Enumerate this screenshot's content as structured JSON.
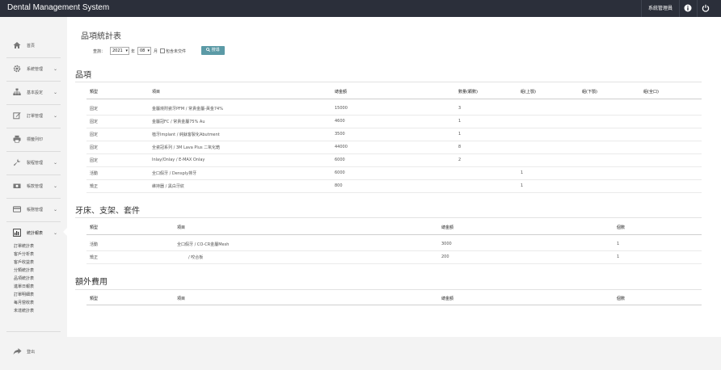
{
  "app": {
    "title": "Dental Management System",
    "admin_label": "系統管理員"
  },
  "sidebar": {
    "items": [
      {
        "label": "首頁",
        "icon": "home-icon",
        "has_sub": false
      },
      {
        "label": "系統管理",
        "icon": "gear-icon",
        "has_sub": true
      },
      {
        "label": "基本設定",
        "icon": "sitemap-icon",
        "has_sub": true
      },
      {
        "label": "訂單管理",
        "icon": "edit-icon",
        "has_sub": true
      },
      {
        "label": "標籤列印",
        "icon": "printer-icon",
        "has_sub": false
      },
      {
        "label": "製程管理",
        "icon": "wrench-icon",
        "has_sub": true
      },
      {
        "label": "帳款管理",
        "icon": "money-icon",
        "has_sub": true
      },
      {
        "label": "帳務管理",
        "icon": "card-icon",
        "has_sub": true
      },
      {
        "label": "統計報表",
        "icon": "chart-icon",
        "has_sub": true
      }
    ],
    "subitems": [
      "訂單統計表",
      "客戶分析表",
      "客戶收益表",
      "分類統計表",
      "品項統計表",
      "進單日報表",
      "訂單明細表",
      "每月營收表",
      "未達統計表"
    ],
    "logout_label": "登出"
  },
  "page": {
    "title": "品項統計表",
    "filter": {
      "query_label": "查詢：",
      "year": "2021",
      "year_unit": "年",
      "month": "08",
      "month_unit": "月",
      "checkbox_label": "包含未交件",
      "search_label": "搜尋"
    }
  },
  "sections": {
    "items": {
      "title": "品項",
      "headers": [
        "類型",
        "項目",
        "總金額",
        "數量(顆數)",
        "組(上顎)",
        "組(下顎)",
        "組(全口)"
      ],
      "rows": [
        [
          "固定",
          "金屬燒附瓷牙PFM  /  常貴金屬-黃金74%",
          "15000",
          "3",
          "",
          "",
          ""
        ],
        [
          "固定",
          "金屬冠FC  /  常貴金屬75% Au",
          "4600",
          "1",
          "",
          "",
          ""
        ],
        [
          "固定",
          "植牙Implant  /  純鈦客製化Abutment",
          "3500",
          "1",
          "",
          "",
          ""
        ],
        [
          "固定",
          "全瓷冠系列  /  3M Lava Plus 二氧化鋯",
          "44000",
          "8",
          "",
          "",
          ""
        ],
        [
          "固定",
          "Inlay/Onlay  /  E-MAX Onlay",
          "6000",
          "2",
          "",
          "",
          ""
        ],
        [
          "活動",
          "全口假牙  /  Densply排牙",
          "6000",
          "",
          "1",
          "",
          ""
        ],
        [
          "矯正",
          "維持器  /  黑白牙紋",
          "800",
          "",
          "1",
          "",
          ""
        ]
      ]
    },
    "frames": {
      "title": "牙床、支架、套件",
      "headers": [
        "類型",
        "項目",
        "總金額",
        "個數"
      ],
      "rows": [
        [
          "活動",
          "全口假牙  /  CO-CR金屬Mesh",
          "3000",
          "1"
        ],
        [
          "矯正",
          "/  咬合板",
          "200",
          "1"
        ]
      ]
    },
    "extra": {
      "title": "額外費用",
      "headers": [
        "類型",
        "項目",
        "總金額",
        "個數"
      ],
      "rows": []
    }
  },
  "colors": {
    "topbar": "#2b2f3a",
    "button": "#5b9aa6"
  }
}
